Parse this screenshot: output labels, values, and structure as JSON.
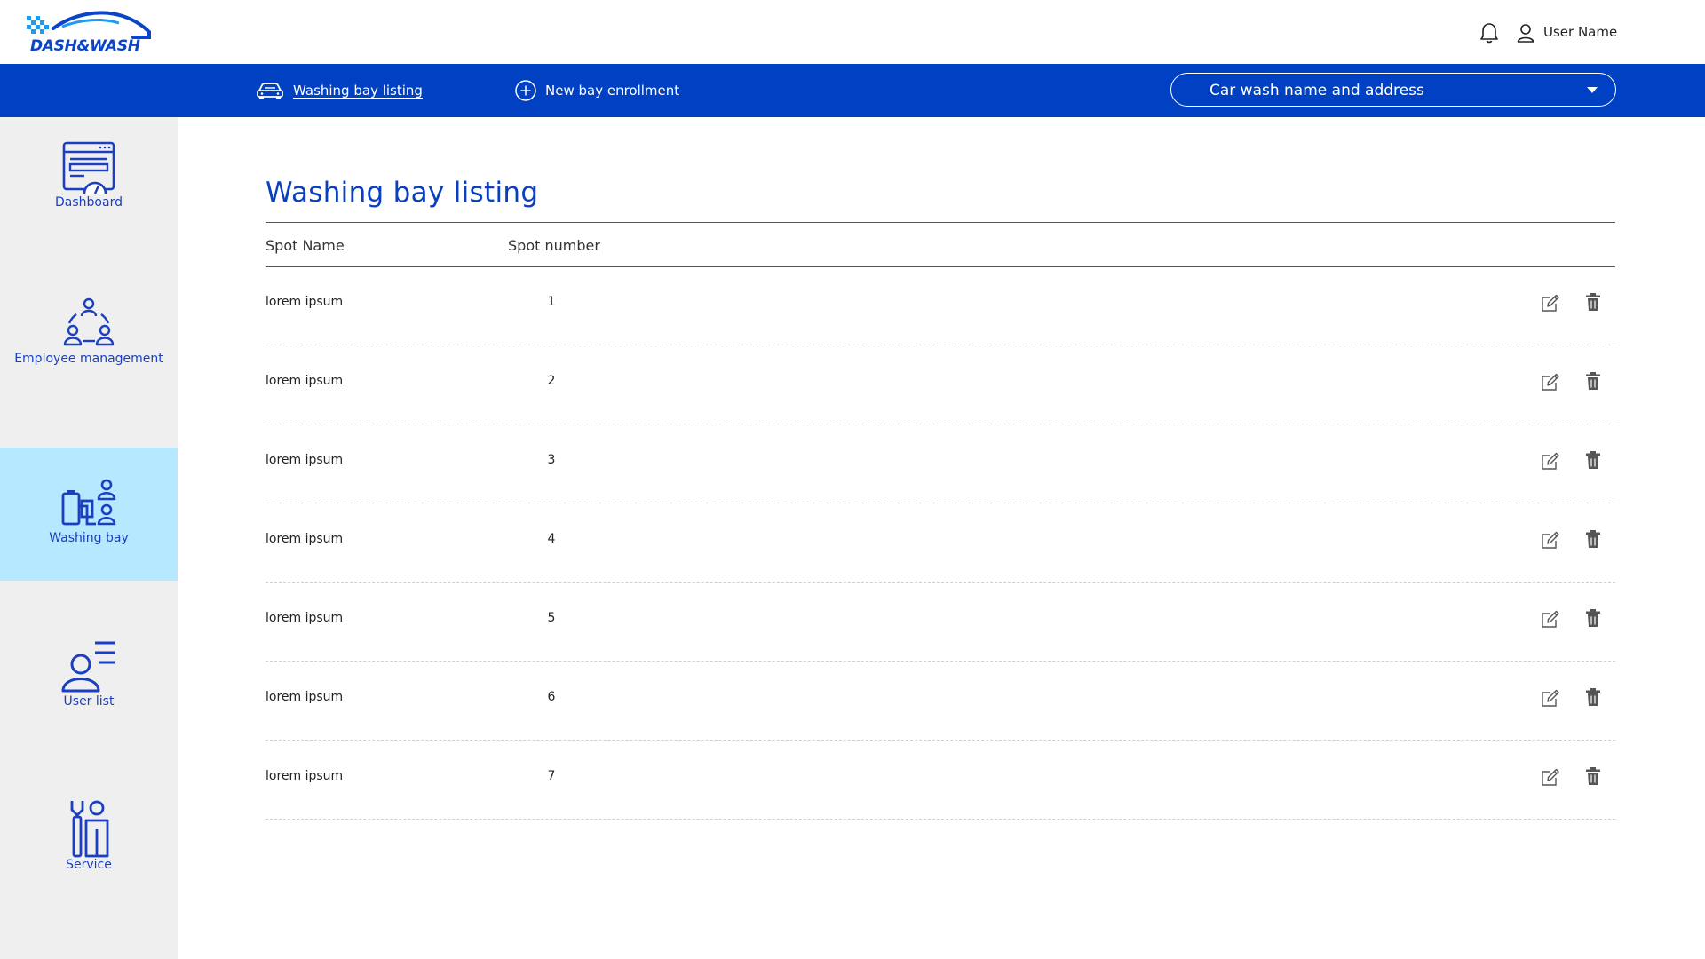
{
  "brand": {
    "logo_text": "DASH&WASH",
    "accent": "#0041c4",
    "active_bg": "#b6e8ff"
  },
  "header": {
    "user_name": "User Name",
    "bell_icon": "bell-icon",
    "user_icon": "user-icon"
  },
  "nav": {
    "listing_label": "Washing bay listing",
    "enroll_label": "New bay enrollment",
    "select_value": "Car wash name and address"
  },
  "sidebar": {
    "items": [
      {
        "label": "Dashboard",
        "icon": "dashboard-icon"
      },
      {
        "label": "Employee management",
        "icon": "employee-group-icon"
      },
      {
        "label": "Washing bay",
        "icon": "washing-bay-icon",
        "active": true
      },
      {
        "label": "User list",
        "icon": "user-list-icon"
      },
      {
        "label": "Service",
        "icon": "service-icon"
      }
    ]
  },
  "main": {
    "title": "Washing bay listing",
    "columns": [
      "Spot Name",
      "Spot number"
    ],
    "rows": [
      {
        "name": "lorem ipsum",
        "number": "1"
      },
      {
        "name": "lorem ipsum",
        "number": "2"
      },
      {
        "name": "lorem ipsum",
        "number": "3"
      },
      {
        "name": "lorem ipsum",
        "number": "4"
      },
      {
        "name": "lorem ipsum",
        "number": "5"
      },
      {
        "name": "lorem ipsum",
        "number": "6"
      },
      {
        "name": "lorem ipsum",
        "number": "7"
      }
    ]
  }
}
